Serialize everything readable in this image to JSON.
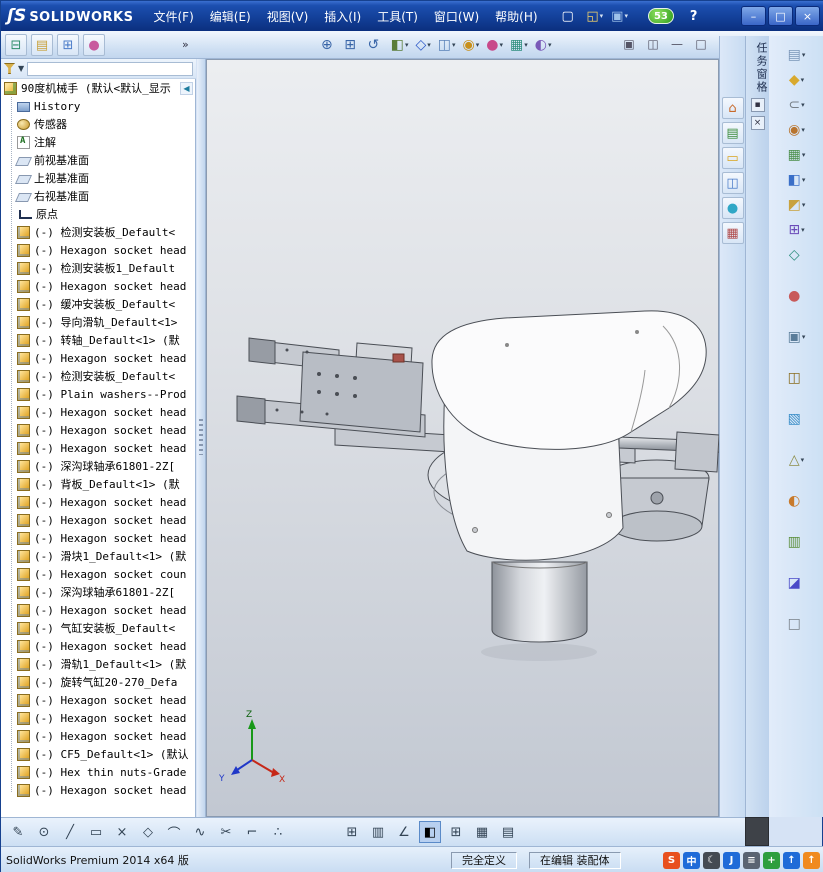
{
  "titlebar": {
    "logo_mark": "ʃS",
    "logo_text": "SOLIDWORKS",
    "menus": [
      "文件(F)",
      "编辑(E)",
      "视图(V)",
      "插入(I)",
      "工具(T)",
      "窗口(W)",
      "帮助(H)"
    ],
    "file_tools": [
      {
        "name": "new-document-icon",
        "glyph": "▢",
        "color": "#FFFFFF",
        "arrow": false
      },
      {
        "name": "open-document-icon",
        "glyph": "◱",
        "color": "#F2D26A",
        "arrow": true
      },
      {
        "name": "save-icon",
        "glyph": "▣",
        "color": "#9FC2EA",
        "arrow": true
      }
    ],
    "badge": "53",
    "help": "?",
    "window_buttons": {
      "minimize": "–",
      "restore": "□",
      "close": "×"
    }
  },
  "manager_tabs": {
    "tabs": [
      {
        "name": "featuremanager-tab-icon",
        "glyph": "⊟",
        "color": "#2E8E6A"
      },
      {
        "name": "propertymanager-tab-icon",
        "glyph": "▤",
        "color": "#C8A23E"
      },
      {
        "name": "configurationmanager-tab-icon",
        "glyph": "⊞",
        "color": "#4A7BC8"
      },
      {
        "name": "displaymanager-tab-icon",
        "glyph": "●",
        "color": "#C85A9E"
      }
    ],
    "overflow": "»"
  },
  "view_toolbar": [
    {
      "name": "zoom-to-fit-icon",
      "glyph": "⊕",
      "color": "#3A66A8",
      "arrow": false
    },
    {
      "name": "zoom-to-area-icon",
      "glyph": "⊞",
      "color": "#3A66A8",
      "arrow": false
    },
    {
      "name": "previous-view-icon",
      "glyph": "↺",
      "color": "#3A66A8",
      "arrow": false
    },
    {
      "name": "section-view-icon",
      "glyph": "◧",
      "color": "#5A7D3A",
      "arrow": true
    },
    {
      "name": "view-orientation-icon",
      "glyph": "◇",
      "color": "#2E5AC8",
      "arrow": true
    },
    {
      "name": "display-style-icon",
      "glyph": "◫",
      "color": "#5A82B8",
      "arrow": true
    },
    {
      "name": "hide-show-items-icon",
      "glyph": "◉",
      "color": "#C8901A",
      "arrow": true
    },
    {
      "name": "edit-appearance-icon",
      "glyph": "●",
      "color": "#C84A8A",
      "arrow": true
    },
    {
      "name": "apply-scene-icon",
      "glyph": "▦",
      "color": "#2E8E7E",
      "arrow": true
    },
    {
      "name": "view-settings-icon",
      "glyph": "◐",
      "color": "#7A5AB8",
      "arrow": true
    }
  ],
  "doc_window_buttons": [
    {
      "name": "new-window-icon",
      "glyph": "▣"
    },
    {
      "name": "tile-windows-icon",
      "glyph": "◫"
    },
    {
      "name": "minimize-doc-icon",
      "glyph": "—"
    },
    {
      "name": "restore-doc-icon",
      "glyph": "□"
    },
    {
      "name": "close-doc-icon",
      "glyph": "×"
    }
  ],
  "feature_tree": {
    "collapse_glyph": "◀",
    "items": [
      {
        "icon": "assembly",
        "label": "90度机械手 (默认<默认_显示"
      },
      {
        "icon": "history",
        "label": "History"
      },
      {
        "icon": "sensors",
        "label": "传感器"
      },
      {
        "icon": "annotations",
        "label": "注解"
      },
      {
        "icon": "plane",
        "label": "前视基准面"
      },
      {
        "icon": "plane",
        "label": "上视基准面"
      },
      {
        "icon": "plane",
        "label": "右视基准面"
      },
      {
        "icon": "origin",
        "label": "原点"
      },
      {
        "icon": "part",
        "label": "(-) 检测安装板_Default<"
      },
      {
        "icon": "part",
        "label": "(-) Hexagon socket head"
      },
      {
        "icon": "part",
        "label": "(-) 检测安装板1_Default"
      },
      {
        "icon": "part",
        "label": "(-) Hexagon socket head"
      },
      {
        "icon": "part",
        "label": "(-) 缓冲安装板_Default<"
      },
      {
        "icon": "part",
        "label": "(-) 导向滑轨_Default<1>"
      },
      {
        "icon": "part",
        "label": "(-) 转轴_Default<1> (默"
      },
      {
        "icon": "part",
        "label": "(-) Hexagon socket head"
      },
      {
        "icon": "part",
        "label": "(-) 检测安装板_Default<"
      },
      {
        "icon": "part",
        "label": "(-) Plain washers--Prod"
      },
      {
        "icon": "part",
        "label": "(-) Hexagon socket head"
      },
      {
        "icon": "part",
        "label": "(-) Hexagon socket head"
      },
      {
        "icon": "part",
        "label": "(-) Hexagon socket head"
      },
      {
        "icon": "part",
        "label": "(-) 深沟球轴承61801-2Z["
      },
      {
        "icon": "part",
        "label": "(-) 背板_Default<1> (默"
      },
      {
        "icon": "part",
        "label": "(-) Hexagon socket head"
      },
      {
        "icon": "part",
        "label": "(-) Hexagon socket head"
      },
      {
        "icon": "part",
        "label": "(-) Hexagon socket head"
      },
      {
        "icon": "part",
        "label": "(-) 滑块1_Default<1> (默"
      },
      {
        "icon": "part",
        "label": "(-) Hexagon socket coun"
      },
      {
        "icon": "part",
        "label": "(-) 深沟球轴承61801-2Z["
      },
      {
        "icon": "part",
        "label": "(-) Hexagon socket head"
      },
      {
        "icon": "part",
        "label": "(-) 气缸安装板_Default<"
      },
      {
        "icon": "part",
        "label": "(-) Hexagon socket head"
      },
      {
        "icon": "part",
        "label": "(-) 滑轨1_Default<1> (默"
      },
      {
        "icon": "part",
        "label": "(-) 旋转气缸20-270_Defa"
      },
      {
        "icon": "part",
        "label": "(-) Hexagon socket head"
      },
      {
        "icon": "part",
        "label": "(-) Hexagon socket head"
      },
      {
        "icon": "part",
        "label": "(-) Hexagon socket head"
      },
      {
        "icon": "part",
        "label": "(-) CF5_Default<1> (默认"
      },
      {
        "icon": "part",
        "label": "(-) Hex thin nuts-Grade"
      },
      {
        "icon": "part",
        "label": "(-) Hexagon socket head"
      }
    ]
  },
  "viewport": {
    "triad": {
      "x_label": "X",
      "y_label": "Y",
      "z_label": "Z"
    }
  },
  "taskpane": {
    "caption": "任务窗格",
    "pin_glyph": "▪",
    "close_glyph": "×",
    "tabs": [
      {
        "name": "solidworks-resources-tab-icon",
        "glyph": "⌂",
        "color": "#C86A2B"
      },
      {
        "name": "design-library-tab-icon",
        "glyph": "▤",
        "color": "#3E8E3E"
      },
      {
        "name": "file-explorer-tab-icon",
        "glyph": "▭",
        "color": "#D9A520"
      },
      {
        "name": "view-palette-tab-icon",
        "glyph": "◫",
        "color": "#4A7BC8"
      },
      {
        "name": "appearances-tab-icon",
        "glyph": "●",
        "color": "#2FA7C6"
      },
      {
        "name": "custom-properties-tab-icon",
        "glyph": "▦",
        "color": "#B04A4A"
      }
    ]
  },
  "right_toolbar_top": [
    {
      "glyph": "▤",
      "color": "#7A96B8",
      "arrow": true
    },
    {
      "glyph": "◆",
      "color": "#D8A92E",
      "arrow": true
    },
    {
      "glyph": "⊂",
      "color": "#788088",
      "arrow": true
    },
    {
      "glyph": "◉",
      "color": "#B8742E",
      "arrow": true
    },
    {
      "glyph": "▦",
      "color": "#4A8E4A",
      "arrow": true
    },
    {
      "glyph": "◧",
      "color": "#3A6FC8",
      "arrow": true
    },
    {
      "glyph": "◩",
      "color": "#C8A23E",
      "arrow": true
    },
    {
      "glyph": "⊞",
      "color": "#6A4AB8",
      "arrow": true
    }
  ],
  "right_toolbar_bottom": [
    {
      "glyph": "◇",
      "color": "#2E8E7E",
      "arrow": false
    },
    {
      "glyph": "●",
      "color": "#C85A5A",
      "arrow": false
    },
    {
      "glyph": "▣",
      "color": "#5A7D9A",
      "arrow": true
    },
    {
      "glyph": "◫",
      "color": "#8A6D1F",
      "arrow": false
    },
    {
      "glyph": "▧",
      "color": "#3A8EC8",
      "arrow": false
    },
    {
      "glyph": "△",
      "color": "#8E8E4A",
      "arrow": true
    },
    {
      "glyph": "◐",
      "color": "#C87A2B",
      "arrow": false
    },
    {
      "glyph": "▥",
      "color": "#5A8E3A",
      "arrow": false
    },
    {
      "glyph": "◪",
      "color": "#4A4AC8",
      "arrow": false
    },
    {
      "glyph": "□",
      "color": "#788088",
      "arrow": false
    }
  ],
  "sketch_toolbar": {
    "group1": [
      {
        "name": "sketch-icon",
        "glyph": "✎",
        "color": "#334455"
      },
      {
        "name": "circle-icon",
        "glyph": "⊙",
        "color": "#334455"
      },
      {
        "name": "line-icon",
        "glyph": "╱",
        "color": "#334455"
      },
      {
        "name": "rectangle-icon",
        "glyph": "▭",
        "color": "#334455"
      },
      {
        "name": "point-icon",
        "glyph": "×",
        "color": "#334455"
      },
      {
        "name": "polygon-icon",
        "glyph": "◇",
        "color": "#334455"
      },
      {
        "name": "arc-icon",
        "glyph": "⌒",
        "color": "#334455"
      },
      {
        "name": "spline-icon",
        "glyph": "∿",
        "color": "#334455"
      },
      {
        "name": "trim-icon",
        "glyph": "✂",
        "color": "#334455"
      },
      {
        "name": "fillet-icon",
        "glyph": "⌐",
        "color": "#334455"
      },
      {
        "name": "pattern-icon",
        "glyph": "∴",
        "color": "#334455"
      }
    ],
    "group2": [
      {
        "name": "mirror-icon",
        "glyph": "⊞",
        "color": "#334455"
      },
      {
        "name": "offset-icon",
        "glyph": "▥",
        "color": "#334455"
      },
      {
        "name": "dimension-icon",
        "glyph": "∠",
        "color": "#334455"
      }
    ],
    "active": {
      "name": "shaded-with-edges-icon",
      "glyph": "◧",
      "color": "#1A3A7A"
    },
    "group3": [
      {
        "name": "table-icon",
        "glyph": "⊞",
        "color": "#334455"
      },
      {
        "name": "bom-table-icon",
        "glyph": "▦",
        "color": "#334455"
      },
      {
        "name": "grid-icon",
        "glyph": "▤",
        "color": "#334455"
      }
    ]
  },
  "statusbar": {
    "left": "SolidWorks Premium 2014 x64 版",
    "define_state": "完全定义",
    "edit_state": "在编辑 装配体",
    "ime_icons": [
      {
        "name": "sogou-icon",
        "glyph": "S",
        "bg": "#E8501E",
        "fg": "#FFFFFF"
      },
      {
        "name": "ime-chinese-icon",
        "glyph": "中",
        "bg": "#1F6BD8",
        "fg": "#FFFFFF"
      },
      {
        "name": "ime-halfwidth-icon",
        "glyph": "☾",
        "bg": "#444A52",
        "fg": "#FFFFFF"
      },
      {
        "name": "ime-punct-icon",
        "glyph": "J",
        "bg": "#1F6BD8",
        "fg": "#FFFFFF"
      },
      {
        "name": "keyboard-icon",
        "glyph": "≡",
        "bg": "#5A6472",
        "fg": "#FFFFFF"
      },
      {
        "name": "ime-tools-icon",
        "glyph": "+",
        "bg": "#2E9E3E",
        "fg": "#FFFFFF"
      },
      {
        "name": "arrow-up-blue-icon",
        "glyph": "↑",
        "bg": "#1F6BD8",
        "fg": "#FFFFFF"
      },
      {
        "name": "arrow-up-orange-icon",
        "glyph": "↑",
        "bg": "#F08A1E",
        "fg": "#FFFFFF"
      }
    ]
  }
}
